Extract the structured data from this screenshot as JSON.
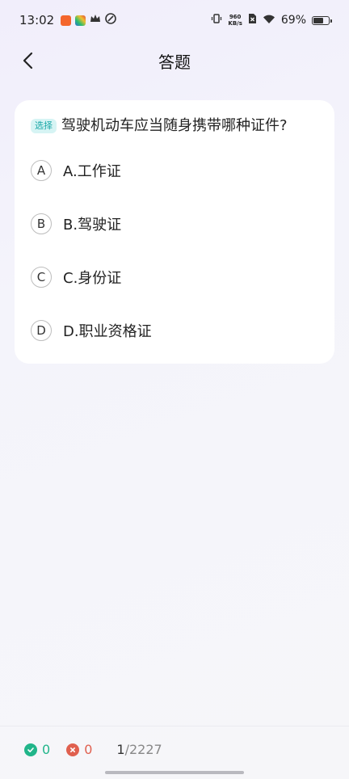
{
  "status_bar": {
    "time": "13:02",
    "net_speed_value": "960",
    "net_speed_unit": "KB/s",
    "battery": "69%",
    "battery_level": 0.69
  },
  "nav": {
    "title": "答题"
  },
  "question": {
    "type_tag": "选择",
    "text": "驾驶机动车应当随身携带哪种证件?",
    "options": [
      {
        "letter": "A",
        "text": "A.工作证"
      },
      {
        "letter": "B",
        "text": "B.驾驶证"
      },
      {
        "letter": "C",
        "text": "C.身份证"
      },
      {
        "letter": "D",
        "text": "D.职业资格证"
      }
    ]
  },
  "footer": {
    "correct_count": "0",
    "wrong_count": "0",
    "current": "1",
    "total": "/2227"
  },
  "colors": {
    "correct": "#21b58a",
    "wrong": "#e0604f",
    "tag_bg": "#d6f4f4",
    "tag_text": "#1aa7a7"
  }
}
